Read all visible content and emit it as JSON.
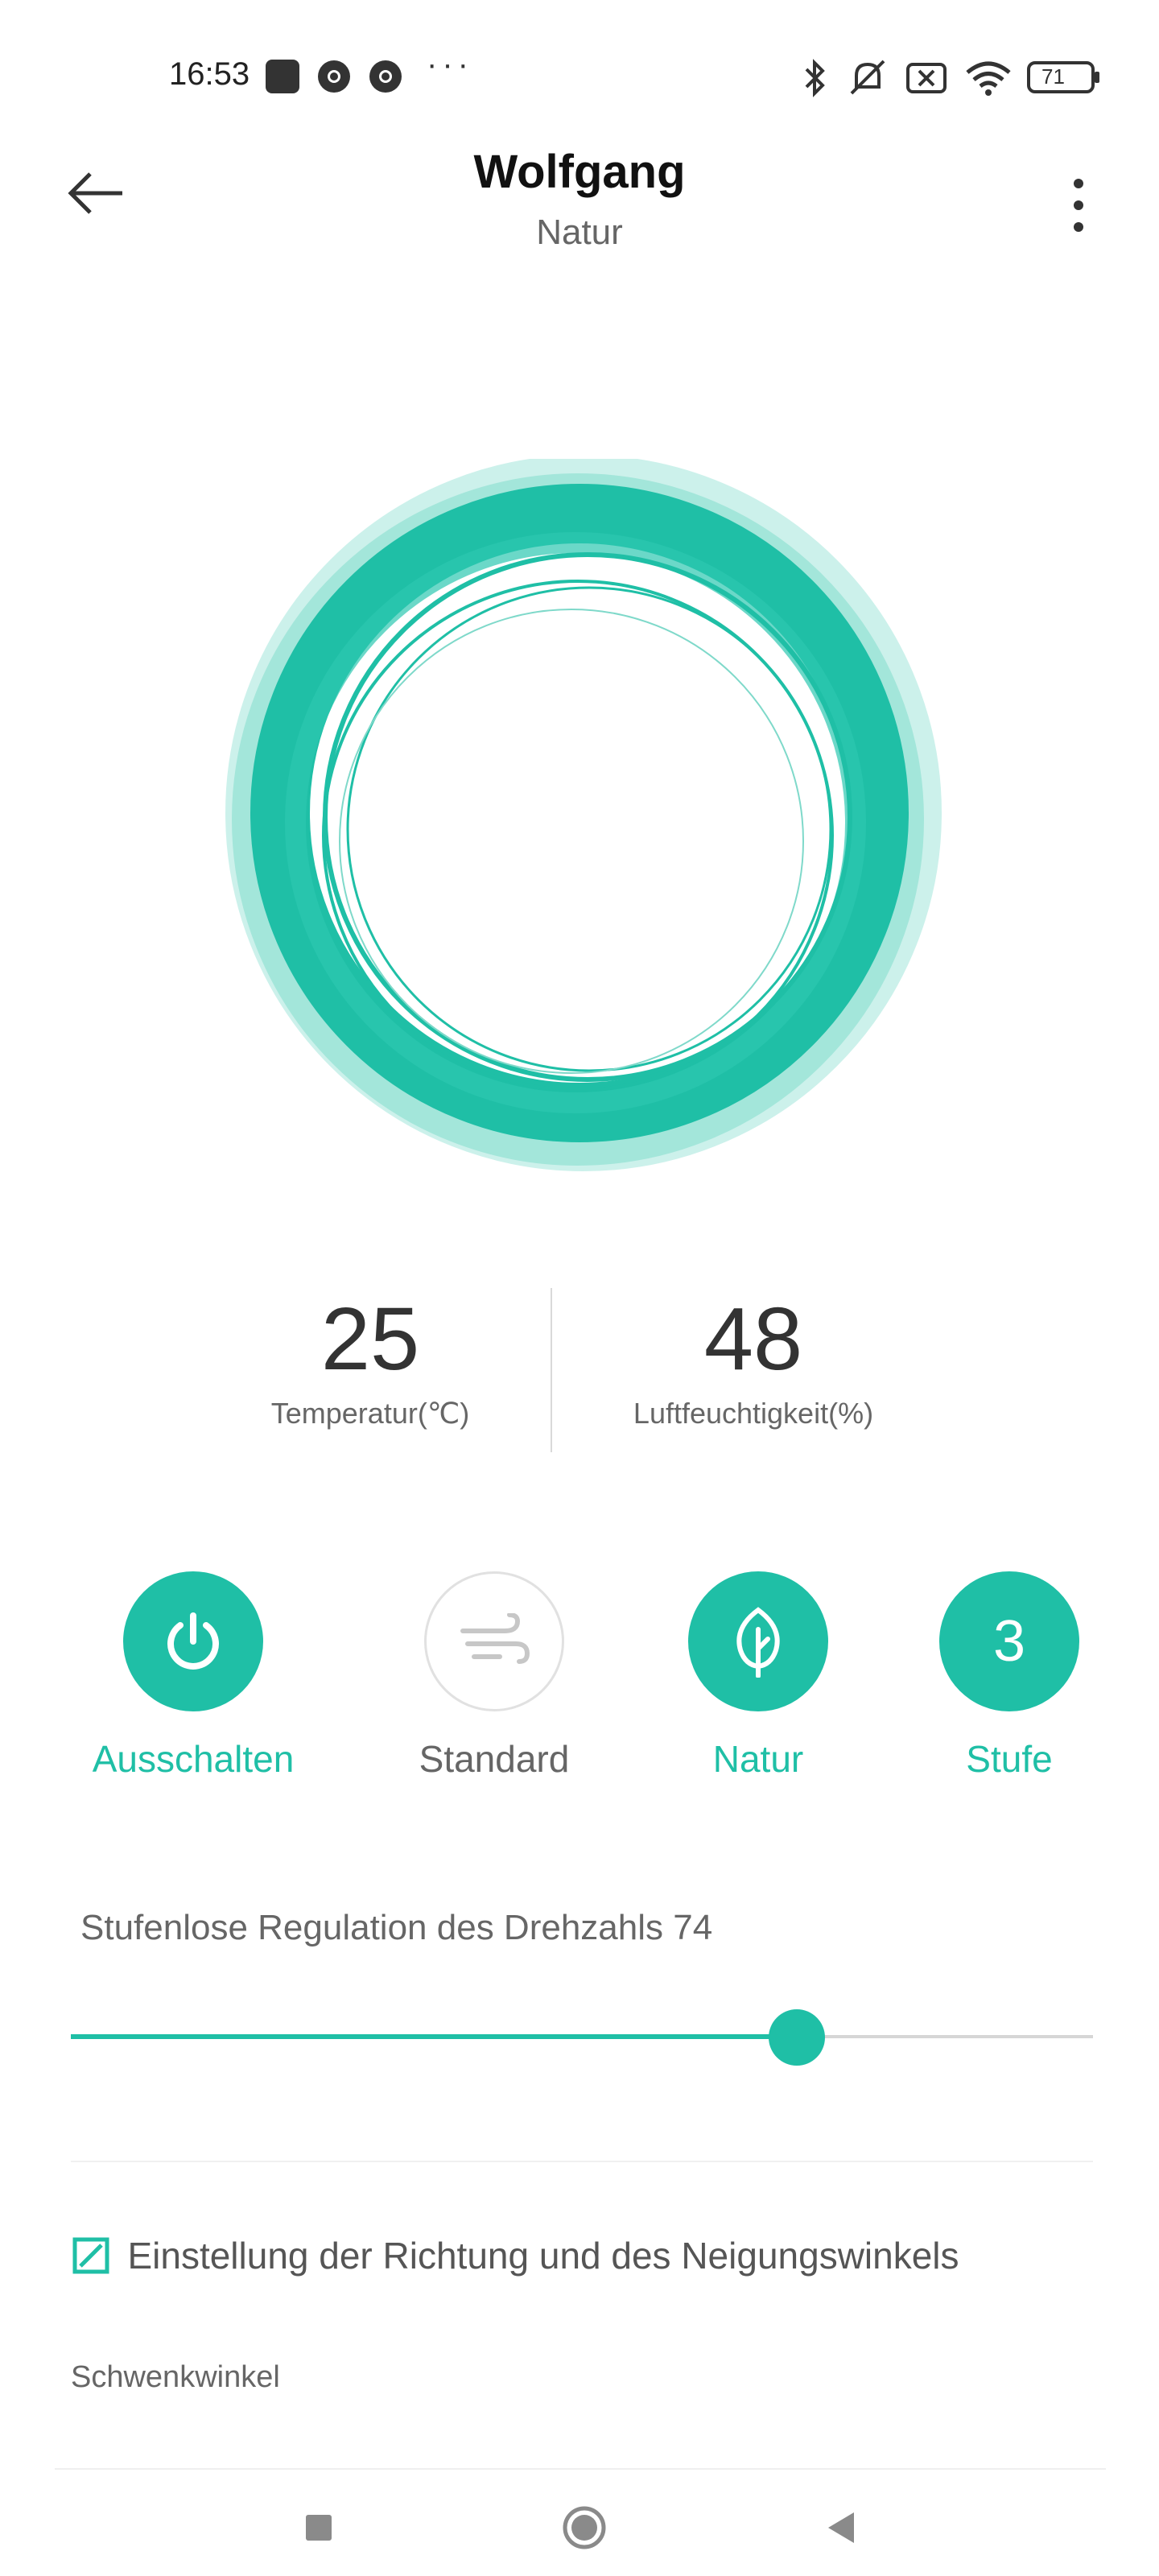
{
  "status_bar": {
    "time": "16:53",
    "battery": "71",
    "icons": [
      "app-icon",
      "chrome-icon",
      "chrome-icon",
      "more-notifications-icon",
      "bluetooth-icon",
      "mute-icon",
      "no-sim-icon",
      "wifi-icon",
      "battery-icon"
    ]
  },
  "header": {
    "title": "Wolfgang",
    "subtitle": "Natur",
    "back_icon": "arrow-left-icon",
    "menu_icon": "more-vertical-icon"
  },
  "stats": {
    "temperature": {
      "value": "25",
      "label": "Temperatur(℃)"
    },
    "humidity": {
      "value": "48",
      "label": "Luftfeuchtigkeit(%)"
    }
  },
  "modes": [
    {
      "label": "Ausschalten",
      "icon": "power-icon",
      "active": true
    },
    {
      "label": "Standard",
      "icon": "wind-icon",
      "active": false
    },
    {
      "label": "Natur",
      "icon": "leaf-icon",
      "active": true
    },
    {
      "label": "Stufe",
      "value": "3",
      "active": true
    }
  ],
  "speed": {
    "label": "Stufenlose Regulation des Drehzahls 74",
    "value": 74,
    "fill_fraction": 0.71
  },
  "direction": {
    "label": "Einstellung der Richtung und des Neigungswinkels",
    "icon": "edit-box-icon"
  },
  "swing": {
    "label": "Schwenkwinkel"
  },
  "nav": [
    "recents-icon",
    "home-icon",
    "back-icon"
  ],
  "colors": {
    "accent": "#1fbfa6",
    "ring_light": "#9ee4d8"
  }
}
